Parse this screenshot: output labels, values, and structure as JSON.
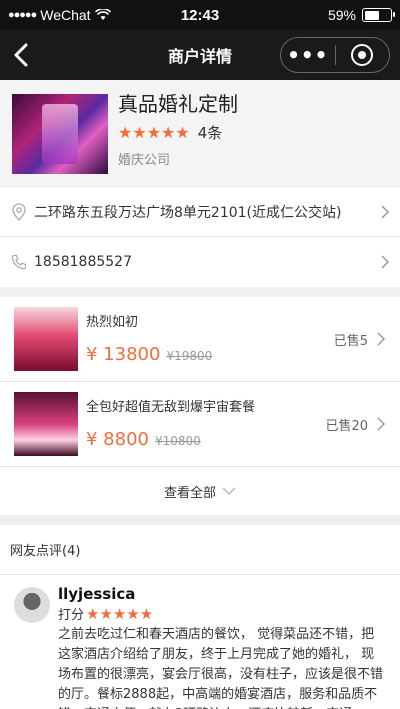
{
  "status_bar": {
    "carrier": "WeChat",
    "time": "12:43",
    "battery": "59%",
    "battery_level": 0.59
  },
  "nav": {
    "title": "商户详情",
    "more_label": "•••"
  },
  "merchant": {
    "name": "真品婚礼定制",
    "rating": 4.5,
    "stars": "★★★★★",
    "review_count": "4条",
    "category": "婚庆公司"
  },
  "contact": {
    "address": "二环路东五段万达广场8单元2101(近成仁公交站)",
    "phone": "18581885527"
  },
  "packages": {
    "items": [
      {
        "name": "热烈如初",
        "price": "¥ 13800",
        "original": "¥19800",
        "sold": "已售5"
      },
      {
        "name": "全包好超值无敌到爆宇宙套餐",
        "price": "¥ 8800",
        "original": "¥10800",
        "sold": "已售20"
      }
    ],
    "see_all": "查看全部"
  },
  "reviews": {
    "header": "网友点评(4)",
    "items": [
      {
        "user": "llyjessica",
        "score_label": "打分",
        "stars": "★★★★★",
        "text": "之前去吃过仁和春天酒店的餐饮， 觉得菜品还不错，把这家酒店介绍给了朋友，终于上月完成了她的婚礼， 现场布置的很漂亮，宴会厅很高，没有柱子，应该是很不错的厅。餐标2888起，中高端的婚宴酒店，服务和品质不错，交通方便，就在2环路边上，酒店比较新，交通"
      }
    ]
  },
  "colors": {
    "accent": "#f26d3d",
    "navbar": "#1a1a1a"
  }
}
